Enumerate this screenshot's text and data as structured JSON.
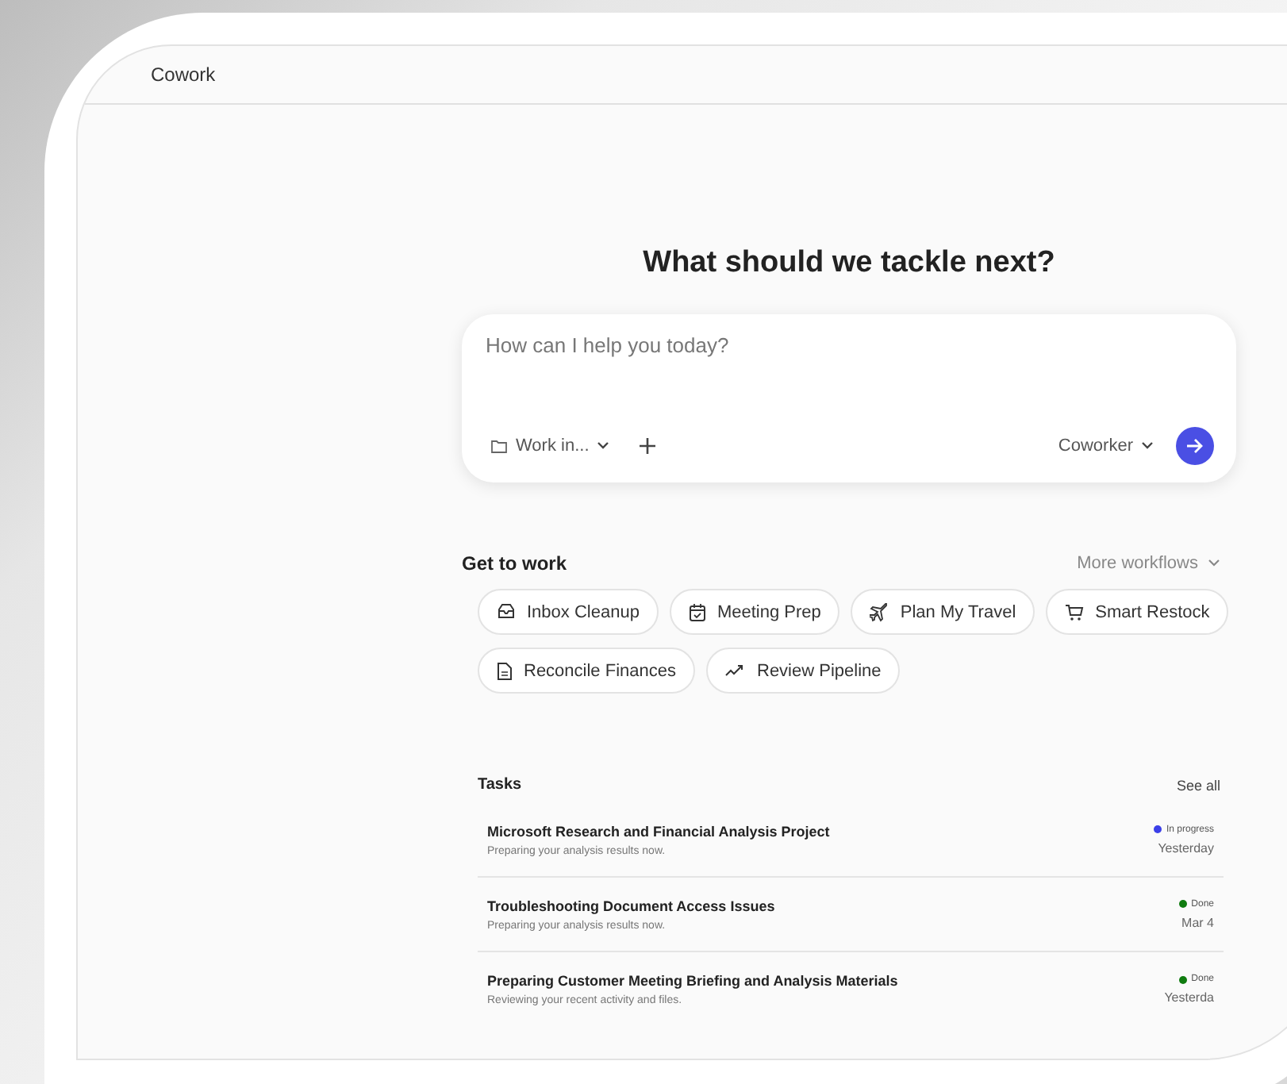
{
  "window": {
    "title": "Cowork"
  },
  "heading": "What should we tackle next?",
  "prompt": {
    "placeholder": "How can I help you today?",
    "folder": "Work in...",
    "mode": "Coworker"
  },
  "workflows": {
    "title": "Get to work",
    "more": "More workflows",
    "items": [
      {
        "label": "Inbox Cleanup",
        "kind": "inbox"
      },
      {
        "label": "Meeting Prep",
        "kind": "calendar"
      },
      {
        "label": "Plan My Travel",
        "kind": "plane"
      },
      {
        "label": "Smart Restock",
        "kind": "cart"
      },
      {
        "label": "Reconcile Finances",
        "kind": "document"
      },
      {
        "label": "Review Pipeline",
        "kind": "trend"
      }
    ]
  },
  "tasks": {
    "title": "Tasks",
    "see_all": "See all",
    "rows": [
      {
        "title": "Microsoft Research and Financial Analysis Project",
        "subtitle": "Preparing your analysis results now.",
        "status": "In progress",
        "color": "#3b3fe8",
        "date": "Yesterday"
      },
      {
        "title": "Troubleshooting Document Access Issues",
        "subtitle": "Preparing your analysis results now.",
        "status": "Done",
        "color": "#107c10",
        "date": "Mar 4"
      },
      {
        "title": "Preparing Customer Meeting Briefing and Analysis Materials",
        "subtitle": "Reviewing your recent activity and files.",
        "status": "Done",
        "color": "#107c10",
        "date": "Yesterda"
      }
    ]
  }
}
